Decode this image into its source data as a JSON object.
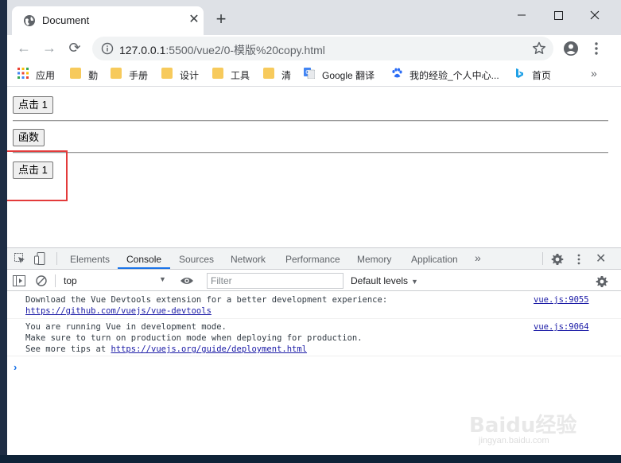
{
  "browser": {
    "tab": {
      "title": "Document"
    },
    "window_controls": {
      "minimize": "─",
      "maximize": "☐",
      "close": "✕"
    },
    "new_tab": "+",
    "nav": {
      "back": "←",
      "forward": "→",
      "reload": "⟳"
    },
    "url": {
      "host": "127.0.0.1",
      "path": ":5500/vue2/0-模版%20copy.html"
    },
    "bookmarks": [
      {
        "label": "应用",
        "icon": "apps-grid-icon"
      },
      {
        "label": "勤",
        "icon": "folder-icon"
      },
      {
        "label": "手册",
        "icon": "folder-icon"
      },
      {
        "label": "设计",
        "icon": "folder-icon"
      },
      {
        "label": "工具",
        "icon": "folder-icon"
      },
      {
        "label": "清",
        "icon": "folder-icon"
      },
      {
        "label": "Google 翻译",
        "icon": "translate-icon"
      },
      {
        "label": "我的经验_个人中心...",
        "icon": "baidu-paw-icon"
      },
      {
        "label": "首页",
        "icon": "bing-icon"
      }
    ],
    "bookmarks_more": "»"
  },
  "page": {
    "button_1": "点击 1",
    "button_func": "函数",
    "button_2": "点击 1"
  },
  "devtools": {
    "tabs": [
      "Elements",
      "Console",
      "Sources",
      "Network",
      "Performance",
      "Memory",
      "Application"
    ],
    "active_tab": "Console",
    "more_tabs": "»",
    "close": "✕",
    "context": "top",
    "context_caret": "▼",
    "filter_placeholder": "Filter",
    "levels": "Default levels",
    "levels_caret": "▼",
    "messages": [
      {
        "lines": [
          "Download the Vue Devtools extension for a better development experience:"
        ],
        "link": "https://github.com/vuejs/vue-devtools",
        "source": "vue.js:9055"
      },
      {
        "lines": [
          "You are running Vue in development mode.",
          "Make sure to turn on production mode when deploying for production."
        ],
        "link_prefix": "See more tips at ",
        "link": "https://vuejs.org/guide/deployment.html",
        "source": "vue.js:9064"
      }
    ],
    "prompt": "›"
  },
  "colors": {
    "accent": "#1a73e8",
    "highlight_box": "#e33b3b",
    "folder": "#f7ca5c"
  },
  "watermark": {
    "logo": "Baidu经验",
    "url": "jingyan.baidu.com"
  }
}
